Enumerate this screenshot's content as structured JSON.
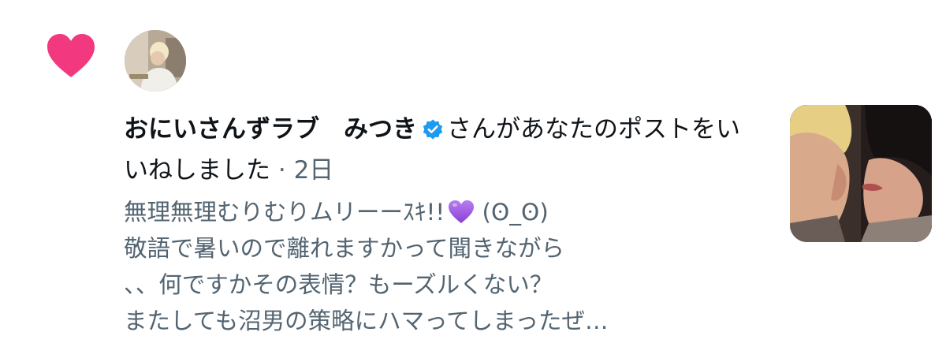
{
  "notification": {
    "type_icon": "heart-icon",
    "accent_color": "#f2387f",
    "avatar_icon": "user-avatar",
    "display_name": "おにいさんずラブ　みつき",
    "verified_icon": "verified-badge-icon",
    "verified_color": "#1d9bf0",
    "action_text": "さんがあなたのポストをいいねしました",
    "separator": " · ",
    "time_ago": "2日",
    "post_excerpt": {
      "line1": "無理無理むりむりムリーーｽｷ!!",
      "line1_emoji": "purple-heart-icon",
      "line1_tail": " (ʘ_ʘ)",
      "line2": "敬語で暑いので離れますかって聞きながら",
      "line3": "、、何ですかその表情？もーズルくない？",
      "line4": "またしても沼男の策略にハマってしまったぜ…"
    },
    "thumbnail": "post-media-thumbnail"
  }
}
